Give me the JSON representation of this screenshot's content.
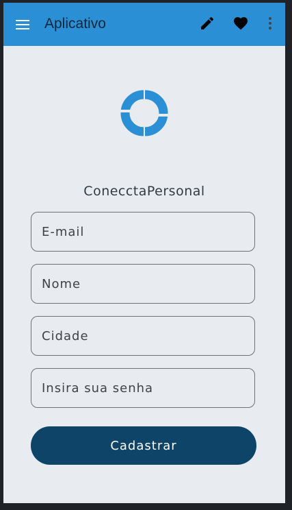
{
  "appbar": {
    "title": "Aplicativo",
    "menu_icon": "hamburger-menu-icon",
    "actions": [
      "edit-pencil-icon",
      "heart-icon",
      "more-vertical-icon"
    ],
    "background_color": "#2b8fd6"
  },
  "brand": {
    "logo_icon": "linked-c-logo",
    "name": "ConecctaPersonal",
    "logo_color": "#2b8fd6"
  },
  "form": {
    "email_placeholder": "E-mail",
    "name_placeholder": "Nome",
    "city_placeholder": "Cidade",
    "password_placeholder": "Insira sua senha",
    "submit_label": "Cadastrar",
    "submit_color": "#0e4468"
  }
}
